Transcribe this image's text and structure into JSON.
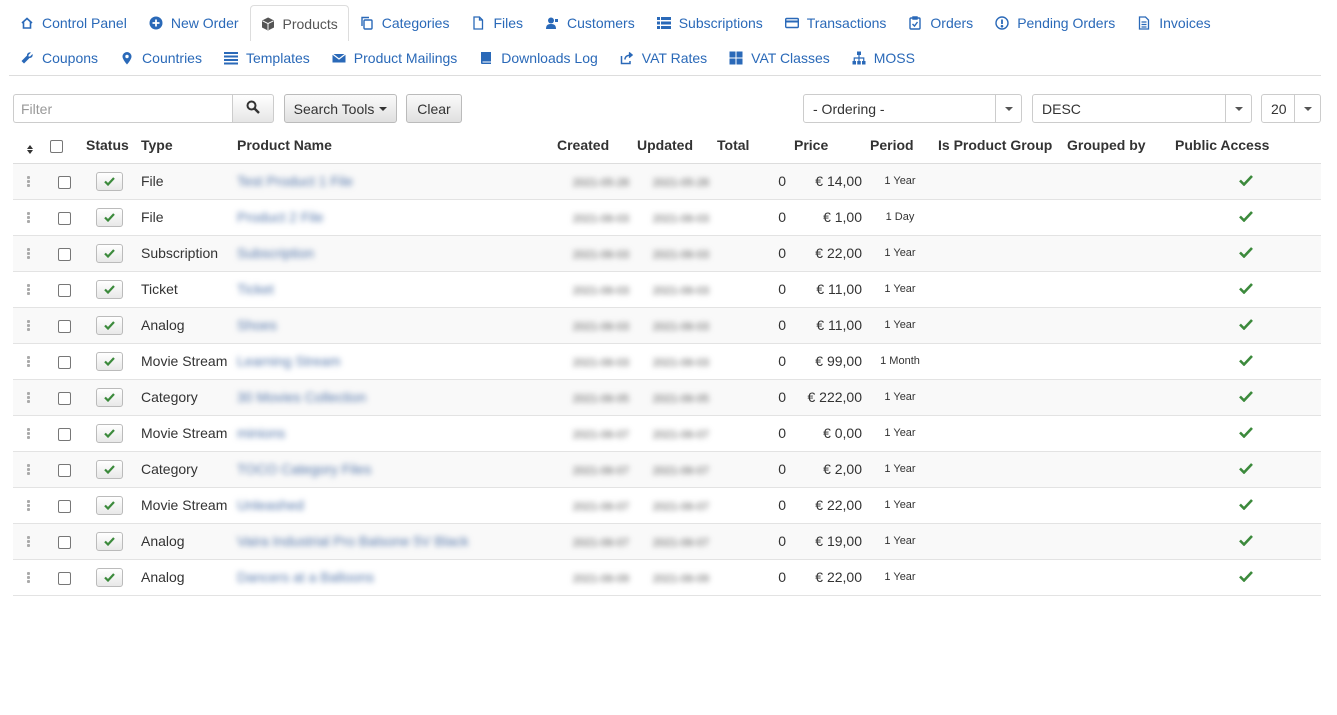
{
  "nav": {
    "row1": [
      {
        "label": "Control Panel",
        "icon": "home-icon"
      },
      {
        "label": "New Order",
        "icon": "plus-circle-icon"
      },
      {
        "label": "Products",
        "icon": "cube-icon",
        "active": true
      },
      {
        "label": "Categories",
        "icon": "copy-icon"
      },
      {
        "label": "Files",
        "icon": "file-icon"
      },
      {
        "label": "Customers",
        "icon": "user-icon"
      },
      {
        "label": "Subscriptions",
        "icon": "list-icon"
      },
      {
        "label": "Transactions",
        "icon": "credit-card-icon"
      },
      {
        "label": "Orders",
        "icon": "clipboard-check-icon"
      },
      {
        "label": "Pending Orders",
        "icon": "exclamation-circle-icon"
      },
      {
        "label": "Invoices",
        "icon": "document-icon"
      }
    ],
    "row2": [
      {
        "label": "Coupons",
        "icon": "wrench-icon"
      },
      {
        "label": "Countries",
        "icon": "location-pin-icon"
      },
      {
        "label": "Templates",
        "icon": "lines-icon"
      },
      {
        "label": "Product Mailings",
        "icon": "envelope-icon"
      },
      {
        "label": "Downloads Log",
        "icon": "book-icon"
      },
      {
        "label": "VAT Rates",
        "icon": "share-icon"
      },
      {
        "label": "VAT Classes",
        "icon": "grid-icon"
      },
      {
        "label": "MOSS",
        "icon": "sitemap-icon"
      }
    ]
  },
  "toolbar": {
    "filter_placeholder": "Filter",
    "filter_value": "",
    "search_tools_label": "Search Tools",
    "clear_label": "Clear",
    "ordering_value": "- Ordering -",
    "direction_value": "DESC",
    "limit_value": "20"
  },
  "table": {
    "headers": {
      "status": "Status",
      "type": "Type",
      "product_name": "Product Name",
      "created": "Created",
      "updated": "Updated",
      "total": "Total",
      "price": "Price",
      "period": "Period",
      "is_product_group": "Is Product Group",
      "grouped_by": "Grouped by",
      "public_access": "Public Access"
    },
    "rows": [
      {
        "type": "File",
        "name": "Test Product 1 File",
        "created": "2021-05-28",
        "updated": "2021-05-28",
        "total": "0",
        "price": "€ 14,00",
        "period": "1 Year"
      },
      {
        "type": "File",
        "name": "Product 2 File",
        "created": "2021-06-03",
        "updated": "2021-06-03",
        "total": "0",
        "price": "€ 1,00",
        "period": "1 Day"
      },
      {
        "type": "Subscription",
        "name": "Subscription",
        "created": "2021-06-03",
        "updated": "2021-06-03",
        "total": "0",
        "price": "€ 22,00",
        "period": "1 Year"
      },
      {
        "type": "Ticket",
        "name": "Ticket",
        "created": "2021-06-03",
        "updated": "2021-06-03",
        "total": "0",
        "price": "€ 11,00",
        "period": "1 Year"
      },
      {
        "type": "Analog",
        "name": "Shoes",
        "created": "2021-06-03",
        "updated": "2021-06-03",
        "total": "0",
        "price": "€ 11,00",
        "period": "1 Year"
      },
      {
        "type": "Movie Stream",
        "name": "Learning Stream",
        "created": "2021-06-03",
        "updated": "2021-06-03",
        "total": "0",
        "price": "€ 99,00",
        "period": "1 Month"
      },
      {
        "type": "Category",
        "name": "30 Movies Collection",
        "created": "2021-06-05",
        "updated": "2021-06-05",
        "total": "0",
        "price": "€ 222,00",
        "period": "1 Year"
      },
      {
        "type": "Movie Stream",
        "name": "minions",
        "created": "2021-06-07",
        "updated": "2021-06-07",
        "total": "0",
        "price": "€ 0,00",
        "period": "1 Year"
      },
      {
        "type": "Category",
        "name": "TOCO Category Files",
        "created": "2021-06-07",
        "updated": "2021-06-07",
        "total": "0",
        "price": "€ 2,00",
        "period": "1 Year"
      },
      {
        "type": "Movie Stream",
        "name": "Unleashed",
        "created": "2021-06-07",
        "updated": "2021-06-07",
        "total": "0",
        "price": "€ 22,00",
        "period": "1 Year"
      },
      {
        "type": "Analog",
        "name": "Vaira Industrial Pro Balsone 5V Black",
        "created": "2021-06-07",
        "updated": "2021-06-07",
        "total": "0",
        "price": "€ 19,00",
        "period": "1 Year"
      },
      {
        "type": "Analog",
        "name": "Dancers at a Balloons",
        "created": "2021-06-09",
        "updated": "2021-06-09",
        "total": "0",
        "price": "€ 22,00",
        "period": "1 Year"
      }
    ]
  },
  "colors": {
    "link": "#2a69b8",
    "check_green": "#3c8a3c"
  }
}
